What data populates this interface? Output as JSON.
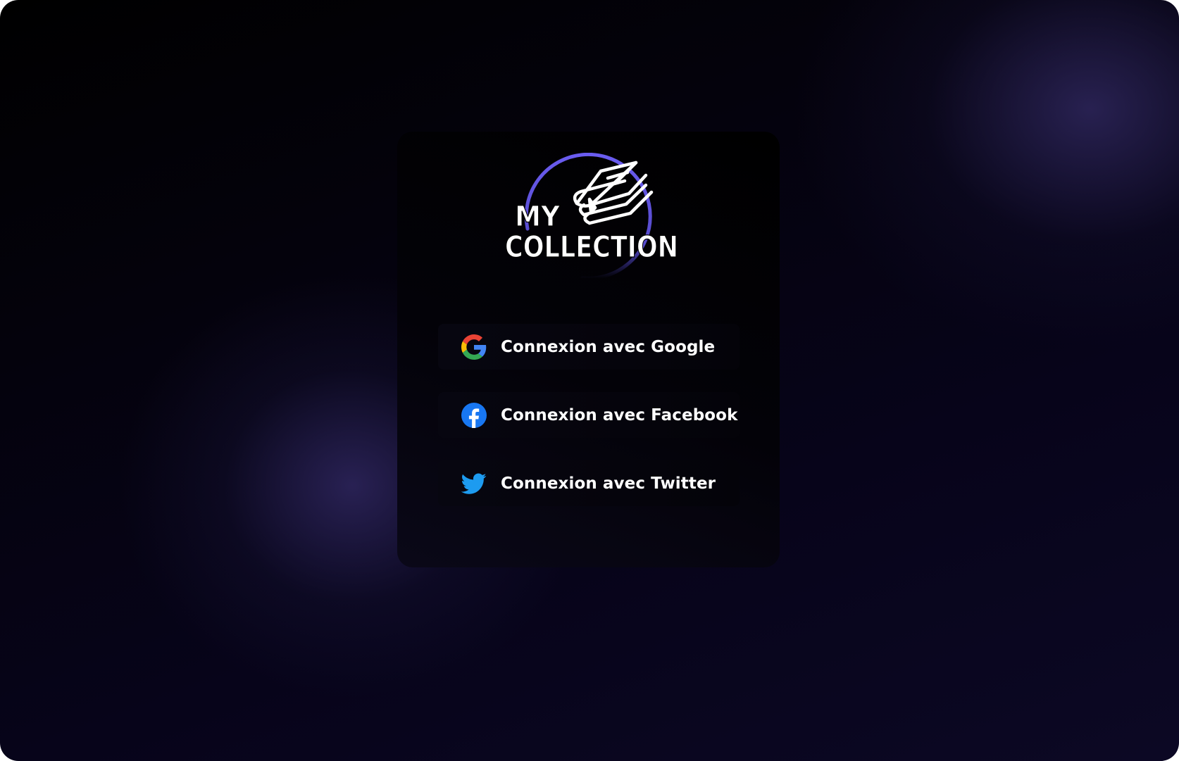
{
  "logo": {
    "line1": "MY",
    "line2": "COLLECTION",
    "accent_color": "#6a5cf0",
    "icon": "stacked-books-icon"
  },
  "login": {
    "buttons": [
      {
        "provider": "google",
        "label": "Connexion avec Google",
        "icon": "google-icon"
      },
      {
        "provider": "facebook",
        "label": "Connexion avec Facebook",
        "icon": "facebook-icon",
        "icon_color": "#1877f2"
      },
      {
        "provider": "twitter",
        "label": "Connexion avec Twitter",
        "icon": "twitter-icon",
        "icon_color": "#1d9bf0"
      }
    ]
  },
  "colors": {
    "background": "#04020c",
    "glow": "#2c245a",
    "card": "#030208",
    "text": "#ffffff"
  }
}
